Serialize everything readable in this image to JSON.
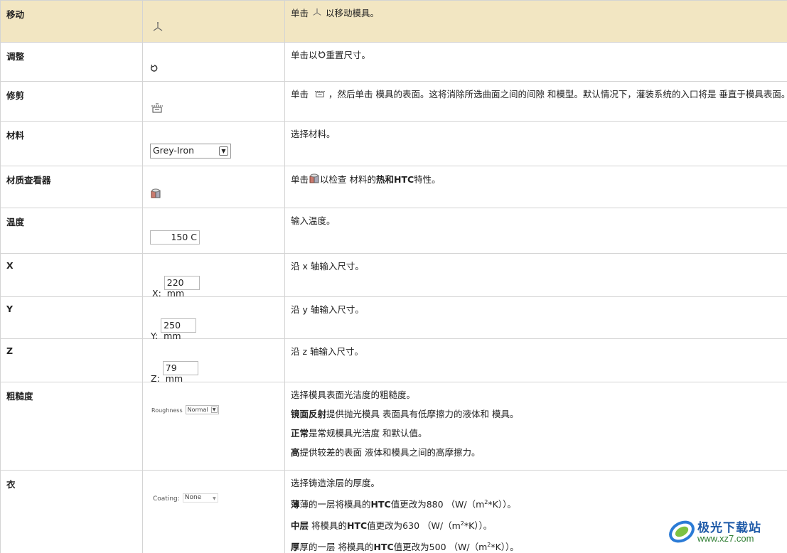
{
  "rows": [
    {
      "name": "移动",
      "desc_a": "单击 ",
      "desc_b": " 以移动模具。"
    },
    {
      "name": "调整",
      "desc_a": "单击以",
      "desc_b": "重置尺寸。"
    },
    {
      "name": "修剪",
      "desc_a": "单击 ",
      "desc_b": "，然后单击 模具的表面。这将消除所选曲面之间的间隙 和模型。默认情况下，灌装系统的入口将是 垂直于模具表面。"
    },
    {
      "name": "材料",
      "select_value": "Grey-Iron",
      "desc": "选择材料。"
    },
    {
      "name": "材质查看器",
      "desc_a": "单击",
      "desc_b": "以检查 材料的",
      "desc_bold": "热和HTC",
      "desc_c": "特性。"
    },
    {
      "name": "温度",
      "value": "150 C",
      "desc": "输入温度。"
    },
    {
      "name": "X",
      "label": "X:",
      "value": "220 mm",
      "desc": "沿 x 轴输入尺寸。"
    },
    {
      "name": "Y",
      "label": "Y:",
      "value": "250 mm",
      "desc": "沿 y 轴输入尺寸。"
    },
    {
      "name": "Z",
      "label": "Z:",
      "value": "79 mm",
      "desc": "沿 z 轴输入尺寸。"
    },
    {
      "name": "粗糙度",
      "label": "Roughness",
      "value": "Normal",
      "desc1": "选择模具表面光洁度的粗糙度。",
      "desc2_bold": "镜面反射",
      "desc2": "提供抛光模具 表面具有低摩擦力的液体和 模具。",
      "desc3_bold": "正常",
      "desc3": "是常规模具光洁度 和默认值。",
      "desc4_bold": "高",
      "desc4": "提供较差的表面 液体和模具之间的高摩擦力。"
    },
    {
      "name": "衣",
      "label": "Coating:",
      "value": "None",
      "desc1": "选择铸造涂层的厚度。",
      "desc2_bold": "薄",
      "desc2_a": "薄的一层将模具的",
      "desc2_htc": "HTC",
      "desc2_b": "值更改为880 （W/（m",
      "desc2_sup": "2",
      "desc2_c": "*K））。",
      "desc3_bold": "中层",
      "desc3_a": " 将模具的",
      "desc3_htc": "HTC",
      "desc3_b": "值更改为630 （W/（m",
      "desc3_sup": "2",
      "desc3_c": "*K））。",
      "desc4_bold": "厚",
      "desc4_a": "厚的一层 将模具的",
      "desc4_htc": "HTC",
      "desc4_b": "值更改为500 （W/（m",
      "desc4_sup": "2",
      "desc4_c": "*K））。"
    }
  ],
  "watermark": {
    "title": "极光下载站",
    "url": "www.xz7.com"
  },
  "colors": {
    "header_bg": "#f2e6c2",
    "border": "#d4d4d4"
  }
}
